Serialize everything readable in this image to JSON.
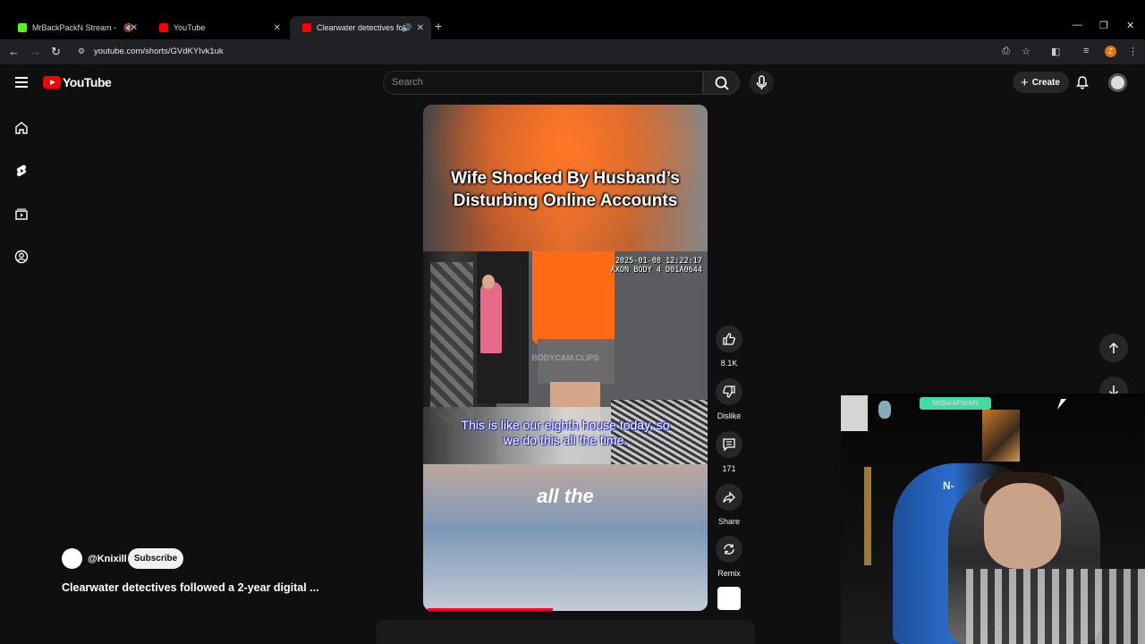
{
  "browser": {
    "tabs": [
      {
        "title": "MrBackPackN Stream - Wat",
        "favicon_color": "#53fc18",
        "active": false,
        "muted": true
      },
      {
        "title": "YouTube",
        "favicon_color": "#ff0000",
        "active": false,
        "muted": false
      },
      {
        "title": "Clearwater detectives follow",
        "favicon_color": "#ff0000",
        "active": true,
        "muted": false
      }
    ],
    "url": "youtube.com/shorts/GVdKYIvk1uk",
    "profile_initial": "Z"
  },
  "header": {
    "logo_text": "YouTube",
    "search_placeholder": "Search",
    "create_label": "Create"
  },
  "short": {
    "title_overlay_line1": "Wife Shocked By Husband’s",
    "title_overlay_line2": "Disturbing Online Accounts",
    "bodycam_line1": "2025-01-08 12:22:17",
    "bodycam_line2": "AXON BODY 4 D01A0644",
    "watermark": "BODYCAM.CLIPS",
    "caption_line1": "This is like our eighth house today, so",
    "caption_line2": "we do this all the time.",
    "lower_text": "all the",
    "progress_fraction": 0.44
  },
  "actions": {
    "like_count": "8.1K",
    "dislike_label": "Dislike",
    "comment_count": "171",
    "share_label": "Share",
    "remix_label": "Remix"
  },
  "channel": {
    "handle": "@Knixill",
    "subscribe_label": "Subscribe",
    "short_title": "Clearwater detectives followed a 2-year digital ..."
  },
  "webcam": {
    "neon_sign": "MrBackPackN",
    "chair_logo": "N-"
  },
  "colors": {
    "accent_red": "#ff0000",
    "background": "#0f0f0f",
    "chip": "#272727"
  }
}
